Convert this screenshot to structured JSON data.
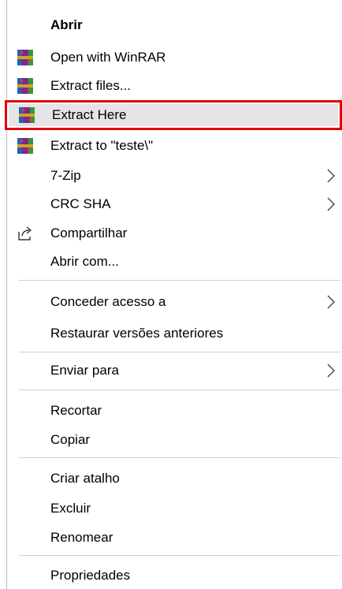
{
  "menu": {
    "items": [
      {
        "label": "Abrir",
        "icon": "none",
        "submenu": false,
        "bold": true
      },
      {
        "label": "Open with WinRAR",
        "icon": "winrar-icon",
        "submenu": false
      },
      {
        "label": "Extract files...",
        "icon": "winrar-icon",
        "submenu": false
      },
      {
        "label": "Extract Here",
        "icon": "winrar-icon",
        "submenu": false,
        "highlighted": true
      },
      {
        "label": "Extract to \"teste\\\"",
        "icon": "winrar-icon",
        "submenu": false
      },
      {
        "label": "7-Zip",
        "icon": "none",
        "submenu": true
      },
      {
        "label": "CRC SHA",
        "icon": "none",
        "submenu": true
      },
      {
        "label": "Compartilhar",
        "icon": "share-icon",
        "submenu": false
      },
      {
        "label": "Abrir com...",
        "icon": "none",
        "submenu": false
      },
      {
        "label": "Conceder acesso a",
        "icon": "none",
        "submenu": true
      },
      {
        "label": "Restaurar versões anteriores",
        "icon": "none",
        "submenu": false
      },
      {
        "label": "Enviar para",
        "icon": "none",
        "submenu": true
      },
      {
        "label": "Recortar",
        "icon": "none",
        "submenu": false
      },
      {
        "label": "Copiar",
        "icon": "none",
        "submenu": false
      },
      {
        "label": "Criar atalho",
        "icon": "none",
        "submenu": false
      },
      {
        "label": "Excluir",
        "icon": "none",
        "submenu": false
      },
      {
        "label": "Renomear",
        "icon": "none",
        "submenu": false
      },
      {
        "label": "Propriedades",
        "icon": "none",
        "submenu": false
      }
    ]
  },
  "colors": {
    "highlight_border": "#e00000",
    "separator": "#d0d0d0",
    "background": "#ffffff"
  }
}
